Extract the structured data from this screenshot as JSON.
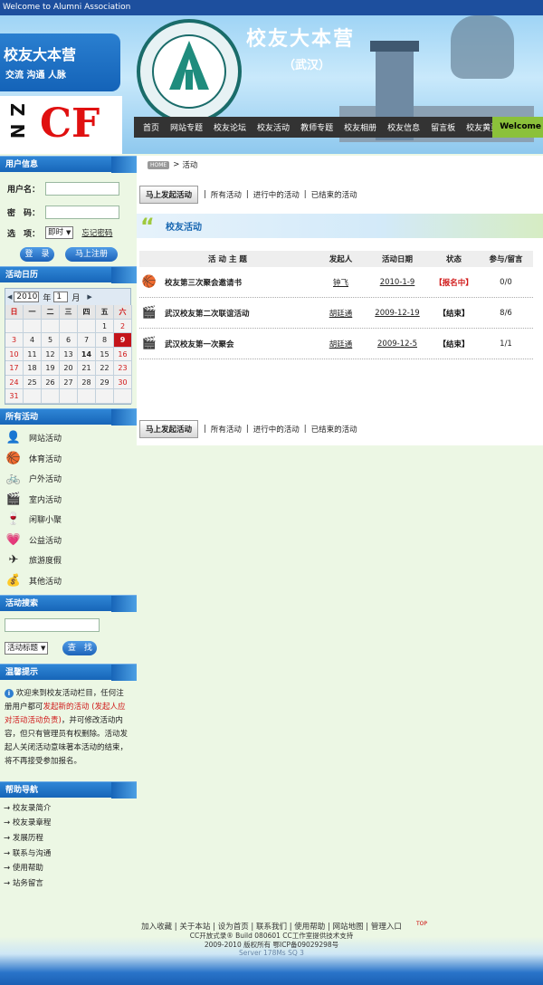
{
  "topbar": {
    "text": "Welcome to Alumni Association"
  },
  "brand": {
    "title": "校友大本营",
    "slogan": "交流 沟通 人脉",
    "logo_letters": "ZN",
    "logo_cf": "CF"
  },
  "banner": {
    "title": "校友大本营",
    "subtitle": "（武汉）"
  },
  "nav": {
    "items": [
      "首页",
      "网站专题",
      "校友论坛",
      "校友活动",
      "教师专题",
      "校友相册",
      "校友信息",
      "留言板",
      "校友黄页"
    ],
    "welcome": "Welcome"
  },
  "sidebar": {
    "user_info": {
      "heading": "用户信息",
      "username_label": "用户名：",
      "password_label": "密　码：",
      "option_label": "选　项：",
      "option_value": "即时",
      "forgot": "忘记密码",
      "login": "登　录",
      "register": "马上注册"
    },
    "calendar": {
      "heading": "活动日历",
      "year": "2010",
      "year_label": "年",
      "month": "1",
      "month_label": "月",
      "weekdays": [
        "日",
        "一",
        "二",
        "三",
        "四",
        "五",
        "六"
      ],
      "days": [
        "",
        "",
        "",
        "",
        "",
        "1",
        "2",
        "3",
        "4",
        "5",
        "6",
        "7",
        "8",
        "9",
        "10",
        "11",
        "12",
        "13",
        "14",
        "15",
        "16",
        "17",
        "18",
        "19",
        "20",
        "21",
        "22",
        "23",
        "24",
        "25",
        "26",
        "27",
        "28",
        "29",
        "30",
        "31",
        "",
        "",
        "",
        "",
        "",
        ""
      ],
      "today": "9",
      "bold_day": "14"
    },
    "activities": {
      "heading": "所有活动",
      "items": [
        {
          "label": "网站活动",
          "icon": "person-icon"
        },
        {
          "label": "体育活动",
          "icon": "ball-icon"
        },
        {
          "label": "户外活动",
          "icon": "bicycle-icon"
        },
        {
          "label": "室内活动",
          "icon": "film-icon"
        },
        {
          "label": "闲聊小聚",
          "icon": "wine-icon"
        },
        {
          "label": "公益活动",
          "icon": "heart-icon"
        },
        {
          "label": "旅游度假",
          "icon": "plane-icon"
        },
        {
          "label": "其他活动",
          "icon": "coins-icon"
        }
      ]
    },
    "search": {
      "heading": "活动搜索",
      "select_value": "活动标题",
      "button": "查　找"
    },
    "notice": {
      "heading": "温馨提示",
      "text1": "欢迎来到校友活动栏目，任何注册用户都可",
      "text_red": "发起新的活动 (发起人应对活动活动负责)",
      "text2": "，并可修改活动内容，但只有管理员有权删除。活动发起人关闭活动意味著本活动的结束，将不再接受参加报名。"
    },
    "help": {
      "heading": "帮助导航",
      "items": [
        "校友录简介",
        "校友录章程",
        "发展历程",
        "联系与沟通",
        "使用帮助",
        "站务留言"
      ]
    }
  },
  "main": {
    "breadcrumb": {
      "home": "HOME",
      "current": "活动"
    },
    "toolbar": {
      "start": "马上发起活动",
      "all": "所有活动",
      "ongoing": "进行中的活动",
      "ended": "已结束的活动"
    },
    "section_title": "校友活动",
    "table": {
      "headers": [
        "活 动 主 题",
        "发起人",
        "活动日期",
        "状态",
        "参与/留言"
      ],
      "rows": [
        {
          "title": "校友第三次聚会邀请书",
          "owner": "钟飞",
          "date": "2010-1-9",
          "status": "【报名中】",
          "count": "0/0",
          "icon": "ball-icon",
          "status_color": "#d01818"
        },
        {
          "title": "武汉校友第二次联谊活动",
          "owner": "胡廷通",
          "date": "2009-12-19",
          "status": "【结束】",
          "count": "8/6",
          "icon": "film-icon",
          "status_color": "#111111"
        },
        {
          "title": "武汉校友第一次聚会",
          "owner": "胡廷通",
          "date": "2009-12-5",
          "status": "【结束】",
          "count": "1/1",
          "icon": "film-icon",
          "status_color": "#111111"
        }
      ]
    }
  },
  "footer": {
    "links": [
      "加入收藏",
      "关于本站",
      "设为首页",
      "联系我们",
      "使用帮助",
      "网站地图",
      "管理入口"
    ],
    "top_label": "TOP",
    "line1": "CC开放式录® Build 080601 CC工作室提供技术支持",
    "line2": "2009-2010 版权所有 鄂ICP备09029298号",
    "line3": "Server 178Ms SQ 3"
  }
}
